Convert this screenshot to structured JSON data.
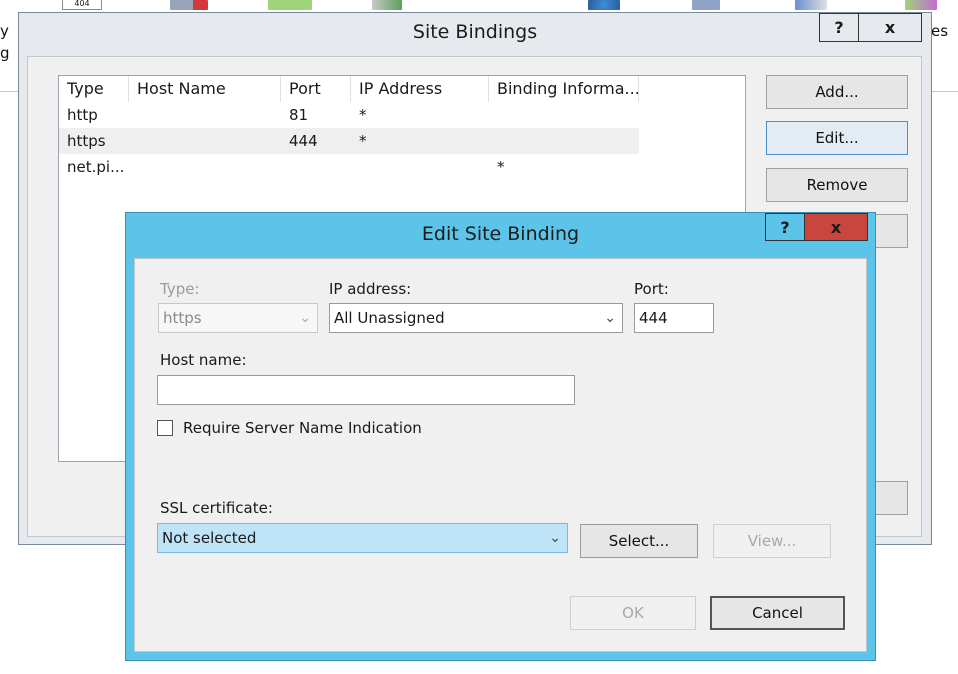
{
  "background": {
    "left_fragments": [
      "y",
      "g"
    ],
    "right_fragment": "es",
    "toolbar_label": "404"
  },
  "site_bindings": {
    "title": "Site Bindings",
    "help_label": "?",
    "close_label": "x",
    "columns": [
      "Type",
      "Host Name",
      "Port",
      "IP Address",
      "Binding Informa..."
    ],
    "rows": [
      {
        "type": "http",
        "host": "",
        "port": "81",
        "ip": "*",
        "info": ""
      },
      {
        "type": "https",
        "host": "",
        "port": "444",
        "ip": "*",
        "info": ""
      },
      {
        "type": "net.pi...",
        "host": "",
        "port": "",
        "ip": "",
        "info": "*"
      }
    ],
    "buttons": {
      "add": "Add...",
      "edit": "Edit...",
      "remove": "Remove"
    }
  },
  "edit_binding": {
    "title": "Edit Site Binding",
    "help_label": "?",
    "close_label": "x",
    "type_label": "Type:",
    "type_value": "https",
    "ip_label": "IP address:",
    "ip_value": "All Unassigned",
    "port_label": "Port:",
    "port_value": "444",
    "host_label": "Host name:",
    "host_value": "",
    "sni_label": "Require Server Name Indication",
    "sni_checked": false,
    "ssl_label": "SSL certificate:",
    "ssl_value": "Not selected",
    "select_button": "Select...",
    "view_button": "View...",
    "ok_button": "OK",
    "cancel_button": "Cancel"
  },
  "colors": {
    "dialog_frame": "#5bc4e8",
    "close_button": "#c9463d",
    "selection": "#bfe3f7"
  }
}
